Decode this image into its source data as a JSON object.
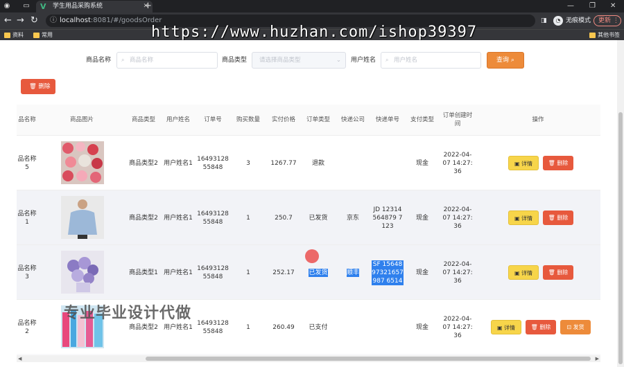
{
  "browser": {
    "tab_title": "学生用品采购系统",
    "url_host": "localhost",
    "url_path": ":8081/#/goodsOrder",
    "incognito_label": "无痕模式",
    "update_label": "更新",
    "bookmarks": [
      "资料",
      "常用"
    ],
    "other_bookmarks": "其他书签"
  },
  "watermark_url": "https://www.huzhan.com/ishop39397",
  "overlay_text": "专业毕业设计代做",
  "search": {
    "name_label": "商品名称",
    "name_placeholder": "商品名称",
    "type_label": "商品类型",
    "type_placeholder": "请选择商品类型",
    "user_label": "用户姓名",
    "user_placeholder": "用户姓名",
    "query_button": "查询"
  },
  "toolbar": {
    "delete_button": "删除"
  },
  "table": {
    "headers": [
      "品名称",
      "商品图片",
      "商品类型",
      "用户姓名",
      "订单号",
      "购买数量",
      "实付价格",
      "订单类型",
      "快递公司",
      "快递单号",
      "支付类型",
      "订单创建时间",
      "操作"
    ],
    "detail_label": "详情",
    "delete_label": "删除",
    "ship_label": "发货",
    "rows": [
      {
        "name": "品名称5",
        "type": "商品类型2",
        "user": "用户姓名1",
        "order_no": "1649312855848",
        "qty": "3",
        "price": "1267.77",
        "status": "退款",
        "courier": "",
        "tracking": "",
        "pay": "现金",
        "created": "2022-04-07 14:27:36"
      },
      {
        "name": "品名称1",
        "type": "商品类型2",
        "user": "用户姓名1",
        "order_no": "1649312855848",
        "qty": "1",
        "price": "250.7",
        "status": "已发货",
        "courier": "京东",
        "tracking": "JD 12314564879 7123",
        "pay": "现金",
        "created": "2022-04-07 14:27:36"
      },
      {
        "name": "品名称3",
        "type": "商品类型1",
        "user": "用户姓名1",
        "order_no": "1649312855848",
        "qty": "1",
        "price": "252.17",
        "status": "已发货",
        "courier": "顺丰",
        "tracking": "SF 1564897321657987 6514",
        "pay": "现金",
        "created": "2022-04-07 14:27:36"
      },
      {
        "name": "品名称2",
        "type": "商品类型2",
        "user": "用户姓名1",
        "order_no": "1649312855848",
        "qty": "1",
        "price": "260.49",
        "status": "已支付",
        "courier": "",
        "tracking": "",
        "pay": "现金",
        "created": "2022-04-07 14:27:36"
      }
    ]
  },
  "colors": {
    "query": "#ed8b3a",
    "delete": "#e7593d",
    "detail": "#f7d54a",
    "highlight": "#2f80ed"
  }
}
